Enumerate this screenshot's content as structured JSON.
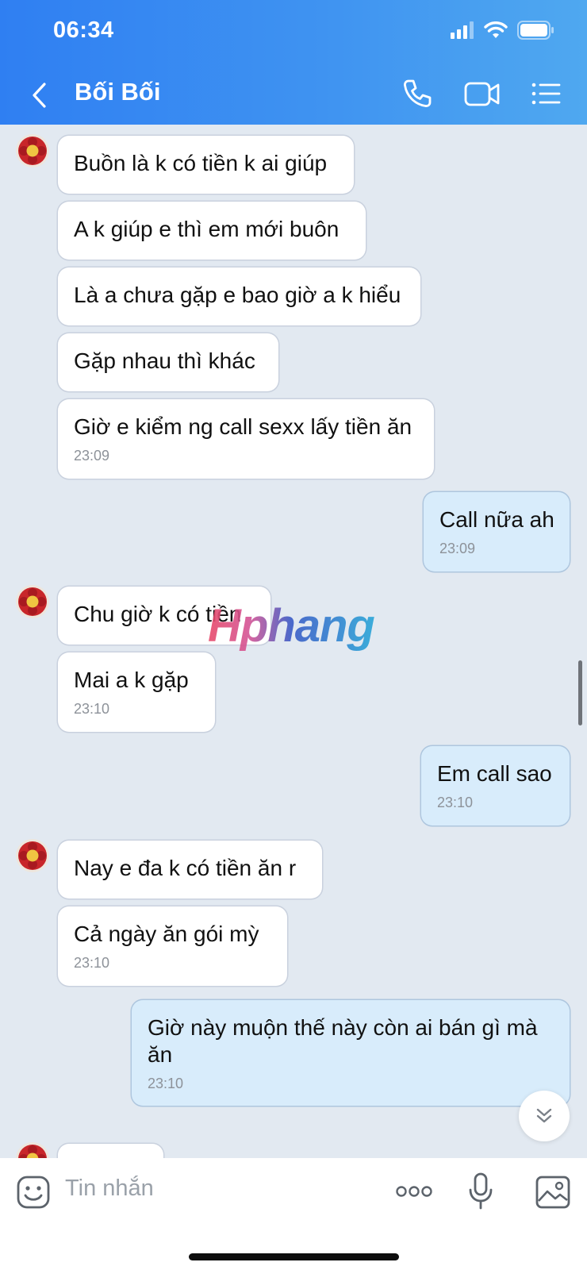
{
  "status_bar": {
    "time": "06:34"
  },
  "header": {
    "title": "Bối Bối"
  },
  "messages": [
    {
      "text": "Buồn là k có tiền k ai giúp"
    },
    {
      "text": "A k giúp e thì em mới buôn"
    },
    {
      "text": "Là a chưa gặp e bao giờ a k hiểu"
    },
    {
      "text": "Gặp nhau thì khác"
    },
    {
      "text": "Giờ e kiểm ng call sexx lấy tiền ăn",
      "time": "23:09"
    },
    {
      "text": "Call nữa ah",
      "time": "23:09"
    },
    {
      "text": "Chu giờ k có tiền"
    },
    {
      "text": "Mai a k gặp",
      "time": "23:10"
    },
    {
      "text": "Em call sao",
      "time": "23:10"
    },
    {
      "text": "Nay e đa k có tiền ăn r"
    },
    {
      "text": "Cả ngày ăn gói mỳ",
      "time": "23:10"
    },
    {
      "text": "Giờ này muộn thế này còn ai bán gì mà ăn",
      "time": "23:10"
    }
  ],
  "watermark": "Hphang",
  "composer": {
    "placeholder": "Tin nhắn"
  },
  "colors": {
    "header_start": "#2f7ff2",
    "header_end": "#4fa8f0",
    "chat_bg": "#e2e9f1",
    "incoming_bubble": "#ffffff",
    "outgoing_bubble": "#d8ecfb"
  },
  "icons": [
    "back-icon",
    "phone-icon",
    "video-call-icon",
    "list-menu-icon",
    "signal-icon",
    "wifi-icon",
    "battery-icon",
    "sticker-icon",
    "more-icon",
    "microphone-icon",
    "image-icon",
    "scroll-down-icon"
  ]
}
